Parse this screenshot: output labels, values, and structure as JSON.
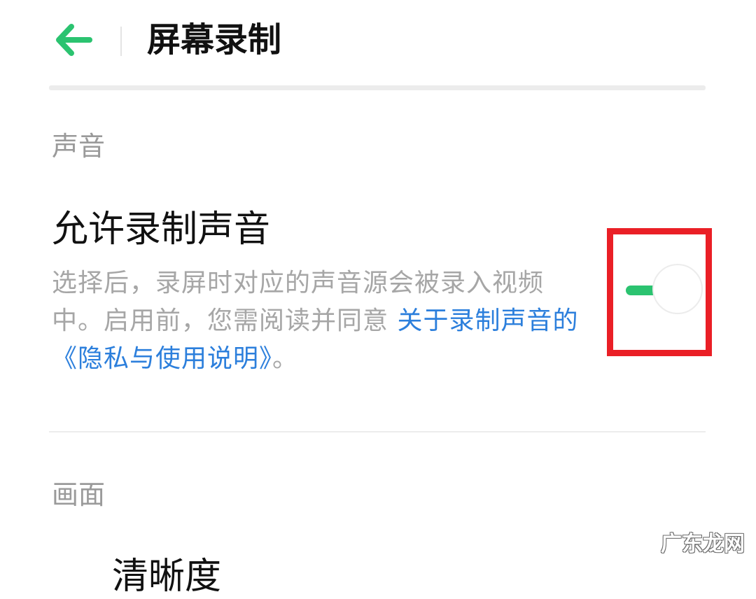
{
  "header": {
    "title": "屏幕录制",
    "back_icon": "arrow-left-icon",
    "accent_color": "#2bc370"
  },
  "sections": {
    "sound": {
      "header": "声音",
      "setting": {
        "title": "允许录制声音",
        "desc_plain": "选择后，录屏时对应的声音源会被录入视频中。启用前，您需阅读并同意 ",
        "desc_link": "关于录制声音的《隐私与使用说明》",
        "desc_end": "。",
        "toggle_on": false,
        "toggle_color": "#2bc370",
        "link_color": "#2c7fdc"
      }
    },
    "picture": {
      "header": "画面",
      "partial_row": "清晰度"
    }
  },
  "highlight": {
    "color": "#ea1f26"
  },
  "watermark": "广东龙网"
}
